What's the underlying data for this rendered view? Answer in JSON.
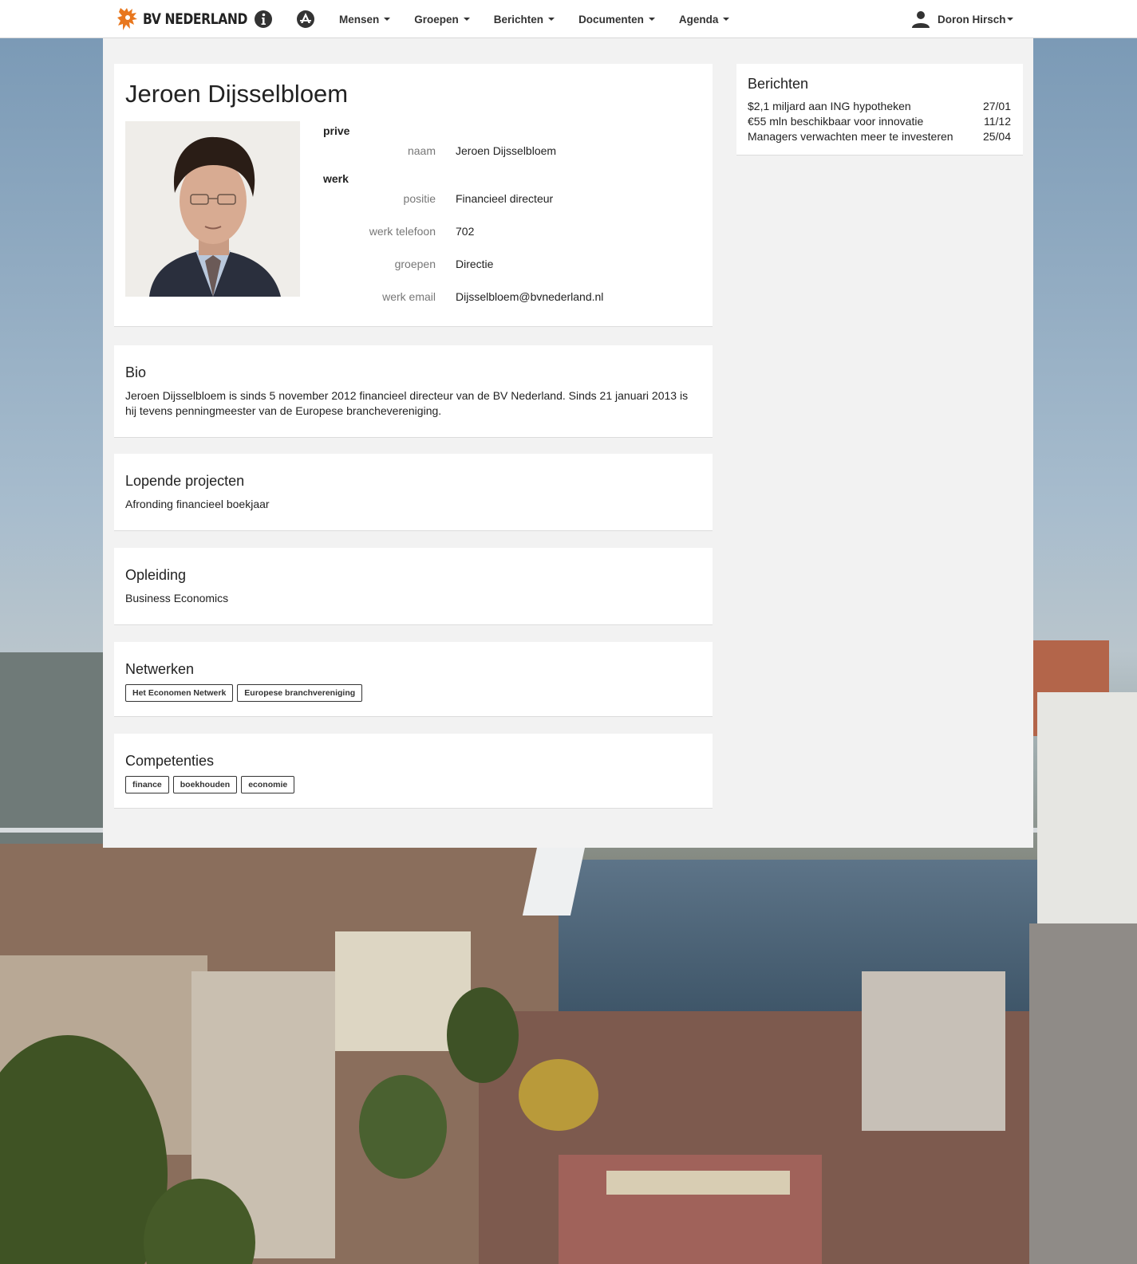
{
  "brand": {
    "name": "BV NEDERLAND"
  },
  "nav": {
    "items": [
      {
        "label": "Mensen"
      },
      {
        "label": "Groepen"
      },
      {
        "label": "Berichten"
      },
      {
        "label": "Documenten"
      },
      {
        "label": "Agenda"
      }
    ],
    "user": "Doron Hirsch"
  },
  "profile": {
    "name": "Jeroen Dijsselbloem",
    "prive_heading": "prive",
    "werk_heading": "werk",
    "fields": [
      {
        "label": "naam",
        "value": "Jeroen Dijsselbloem"
      },
      {
        "label": "positie",
        "value": "Financieel directeur"
      },
      {
        "label": "werk telefoon",
        "value": "702"
      },
      {
        "label": "groepen",
        "value": "Directie"
      },
      {
        "label": "werk email",
        "value": "Dijsselbloem@bvnederland.nl"
      }
    ]
  },
  "bio": {
    "title": "Bio",
    "text": "Jeroen Dijsselbloem is sinds 5 november 2012 financieel directeur van de BV Nederland. Sinds 21 januari 2013 is hij tevens penningmeester van de Europese branchevereniging."
  },
  "projects": {
    "title": "Lopende projecten",
    "text": "Afronding financieel boekjaar"
  },
  "education": {
    "title": "Opleiding",
    "text": "Business Economics"
  },
  "networks": {
    "title": "Netwerken",
    "tags": [
      "Het Economen Netwerk",
      "Europese branchvereniging"
    ]
  },
  "competencies": {
    "title": "Competenties",
    "tags": [
      "finance",
      "boekhouden",
      "economie"
    ]
  },
  "news": {
    "title": "Berichten",
    "items": [
      {
        "title": "$2,1 miljard aan ING hypotheken",
        "date": "27/01"
      },
      {
        "title": "€55 mln beschikbaar voor innovatie",
        "date": "11/12"
      },
      {
        "title": "Managers verwachten meer te investeren",
        "date": "25/04"
      }
    ]
  },
  "icons": {
    "logo": "lion-logo-icon",
    "info": "info-icon",
    "apps": "app-store-icon",
    "user": "user-icon",
    "brand_color": "#e8771e"
  }
}
